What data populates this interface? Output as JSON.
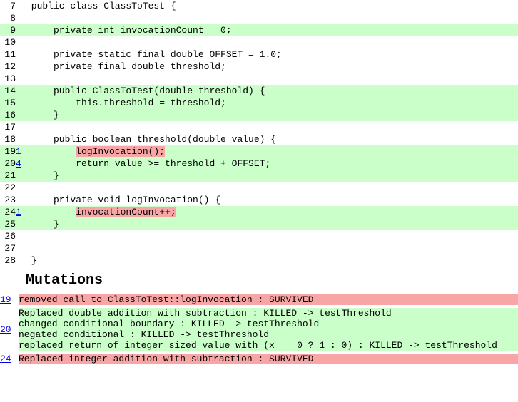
{
  "code": {
    "lines": [
      {
        "n": 7,
        "count": "",
        "covered": false,
        "text": " public class ClassToTest {",
        "inlineBg": ""
      },
      {
        "n": 8,
        "count": "",
        "covered": false,
        "text": "",
        "inlineBg": ""
      },
      {
        "n": 9,
        "count": "",
        "covered": true,
        "text": "     private int invocationCount = 0;",
        "inlineBg": ""
      },
      {
        "n": 10,
        "count": "",
        "covered": false,
        "text": "",
        "inlineBg": ""
      },
      {
        "n": 11,
        "count": "",
        "covered": false,
        "text": "     private static final double OFFSET = 1.0;",
        "inlineBg": ""
      },
      {
        "n": 12,
        "count": "",
        "covered": false,
        "text": "     private final double threshold;",
        "inlineBg": ""
      },
      {
        "n": 13,
        "count": "",
        "covered": false,
        "text": "",
        "inlineBg": ""
      },
      {
        "n": 14,
        "count": "",
        "covered": true,
        "text": "     public ClassToTest(double threshold) {",
        "inlineBg": ""
      },
      {
        "n": 15,
        "count": "",
        "covered": true,
        "text": "         this.threshold = threshold;",
        "inlineBg": ""
      },
      {
        "n": 16,
        "count": "",
        "covered": true,
        "text": "     }",
        "inlineBg": ""
      },
      {
        "n": 17,
        "count": "",
        "covered": false,
        "text": "",
        "inlineBg": ""
      },
      {
        "n": 18,
        "count": "",
        "covered": false,
        "text": "     public boolean threshold(double value) {",
        "inlineBg": ""
      },
      {
        "n": 19,
        "count": "1",
        "covered": true,
        "pre": "         ",
        "highlight": "logInvocation();",
        "inlineBg": "survived"
      },
      {
        "n": 20,
        "count": "4",
        "covered": true,
        "pre": "         ",
        "highlight": "return value >= threshold + OFFSET;",
        "inlineBg": "killed"
      },
      {
        "n": 21,
        "count": "",
        "covered": true,
        "text": "     }",
        "inlineBg": ""
      },
      {
        "n": 22,
        "count": "",
        "covered": false,
        "text": "",
        "inlineBg": ""
      },
      {
        "n": 23,
        "count": "",
        "covered": false,
        "text": "     private void logInvocation() {",
        "inlineBg": ""
      },
      {
        "n": 24,
        "count": "1",
        "covered": true,
        "pre": "         ",
        "highlight": "invocationCount++;",
        "inlineBg": "survived"
      },
      {
        "n": 25,
        "count": "",
        "covered": true,
        "text": "     }",
        "inlineBg": ""
      },
      {
        "n": 26,
        "count": "",
        "covered": false,
        "text": "",
        "inlineBg": ""
      },
      {
        "n": 27,
        "count": "",
        "covered": false,
        "text": "",
        "inlineBg": ""
      },
      {
        "n": 28,
        "count": "",
        "covered": false,
        "text": " }",
        "inlineBg": ""
      }
    ]
  },
  "mutationsHeading": "Mutations",
  "mutations": [
    {
      "line": "19",
      "entries": [
        {
          "status": "survived",
          "text": "removed call to ClassToTest::logInvocation : SURVIVED"
        }
      ]
    },
    {
      "line": "20",
      "entries": [
        {
          "status": "killed",
          "text": "Replaced double addition with subtraction : KILLED -> testThreshold"
        },
        {
          "status": "killed",
          "text": "changed conditional boundary : KILLED -> testThreshold"
        },
        {
          "status": "killed",
          "text": "negated conditional : KILLED -> testThreshold"
        },
        {
          "status": "killed",
          "text": "replaced return of integer sized value with (x == 0 ? 1 : 0) : KILLED -> testThreshold"
        }
      ]
    },
    {
      "line": "24",
      "entries": [
        {
          "status": "survived",
          "text": "Replaced integer addition with subtraction : SURVIVED"
        }
      ]
    }
  ]
}
